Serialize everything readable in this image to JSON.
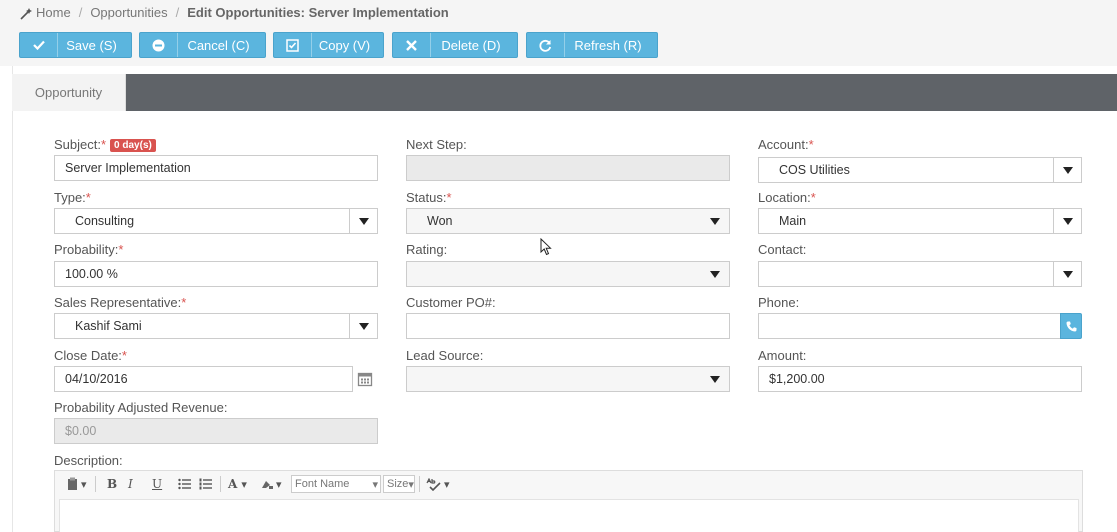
{
  "breadcrumb": {
    "home": "Home",
    "section": "Opportunities",
    "current": "Edit Opportunities: Server Implementation"
  },
  "toolbar": {
    "save": "Save (S)",
    "cancel": "Cancel (C)",
    "copy": "Copy (V)",
    "delete": "Delete (D)",
    "refresh": "Refresh (R)"
  },
  "tabs": {
    "opportunity": "Opportunity"
  },
  "form": {
    "subject": {
      "label": "Subject:",
      "badge": "0 day(s)",
      "value": "Server Implementation"
    },
    "next_step": {
      "label": "Next Step:",
      "value": ""
    },
    "account": {
      "label": "Account:",
      "value": "COS Utilities"
    },
    "type": {
      "label": "Type:",
      "value": "Consulting"
    },
    "status": {
      "label": "Status:",
      "value": "Won"
    },
    "location": {
      "label": "Location:",
      "value": "Main"
    },
    "probability": {
      "label": "Probability:",
      "value": "100.00 %"
    },
    "rating": {
      "label": "Rating:",
      "value": ""
    },
    "contact": {
      "label": "Contact:",
      "value": ""
    },
    "sales_rep": {
      "label": "Sales Representative:",
      "value": "Kashif Sami"
    },
    "customer_po": {
      "label": "Customer PO#:",
      "value": ""
    },
    "phone": {
      "label": "Phone:",
      "value": ""
    },
    "close_date": {
      "label": "Close Date:",
      "value": "04/10/2016"
    },
    "lead_source": {
      "label": "Lead Source:",
      "value": ""
    },
    "amount": {
      "label": "Amount:",
      "value": "$1,200.00"
    },
    "adj_revenue": {
      "label": "Probability Adjusted Revenue:",
      "value": "$0.00"
    },
    "description": {
      "label": "Description:"
    },
    "required_mark": "*"
  },
  "editor": {
    "font_name": "Font Name",
    "size": "Size",
    "bold": "B",
    "italic": "I",
    "underline": "U",
    "font_color": "A"
  },
  "colors": {
    "accent": "#5bb5de",
    "required": "#d9534f",
    "tabbar": "#5f6368"
  }
}
